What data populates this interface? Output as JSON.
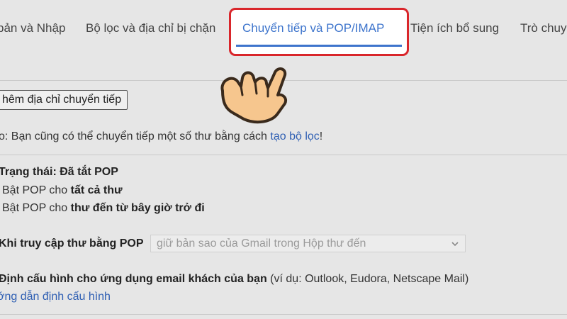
{
  "tabs": [
    {
      "label": "bản và Nhập"
    },
    {
      "label": "Bộ lọc và địa chỉ bị chặn"
    },
    {
      "label": "Chuyển tiếp và POP/IMAP"
    },
    {
      "label": "Tiện ích bổ sung"
    },
    {
      "label": "Trò chuy"
    }
  ],
  "forwarding": {
    "add_address_button": "hêm địa chỉ chuyển tiếp",
    "tip_prefix": "o: Bạn cũng có thể chuyển tiếp một số thư bằng cách ",
    "tip_link": "tạo bộ lọc",
    "tip_suffix": "!"
  },
  "pop": {
    "status": "Trạng thái: Đã tắt POP",
    "option_all_prefix": "Bật POP cho ",
    "option_all_bold": "tất cả thư",
    "option_new_prefix": "Bật POP cho ",
    "option_new_bold": "thư đến từ bây giờ trở đi",
    "access_label": "Khi truy cập thư bằng POP",
    "access_select_value": "giữ bản sao của Gmail trong Hộp thư đến",
    "config_bold": "Định cấu hình cho ứng dụng email khách của bạn",
    "config_note": " (ví dụ: Outlook, Eudora, Netscape Mail)",
    "config_link": "ớng dẫn định cấu hình"
  },
  "colors": {
    "accent": "#3d74cc",
    "highlight_border": "#d9262b",
    "link": "#2f5fb3"
  },
  "icons": {
    "pointer": "pointing-hand-icon",
    "select": "chevron-down-icon"
  }
}
